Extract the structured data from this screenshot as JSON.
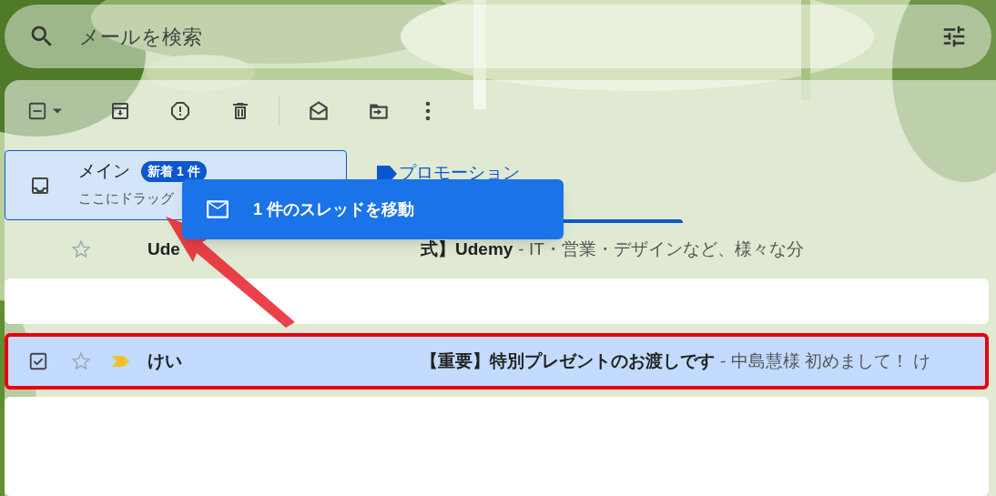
{
  "search": {
    "placeholder": "メールを検索"
  },
  "toolbar": {
    "select_all": {
      "indeterminate": true
    }
  },
  "tabs": [
    {
      "kind": "inbox",
      "label": "メイン",
      "badge": "新着 1 件",
      "subtitle": "ここにドラッグ",
      "selected": false,
      "drop_target": true
    },
    {
      "kind": "tag",
      "label": "プロモーション",
      "selected": true,
      "drop_target": false
    }
  ],
  "drag_tooltip": {
    "text": "1 件のスレッドを移動"
  },
  "rows": [
    {
      "kind": "message",
      "sender": "Ude",
      "subject": "式】Udemy",
      "snippet": "- IT・営業・デザインなど、様々な分",
      "starred": false,
      "important": false,
      "selected": false,
      "highlighted": false
    },
    {
      "kind": "blank"
    },
    {
      "kind": "message",
      "checked": true,
      "sender": "けい",
      "subject": "【重要】特別プレゼントのお渡しです",
      "snippet": "- 中島慧様 初めまして！ け",
      "starred": false,
      "important": true,
      "selected": true,
      "highlighted": true
    },
    {
      "kind": "blank"
    }
  ]
}
